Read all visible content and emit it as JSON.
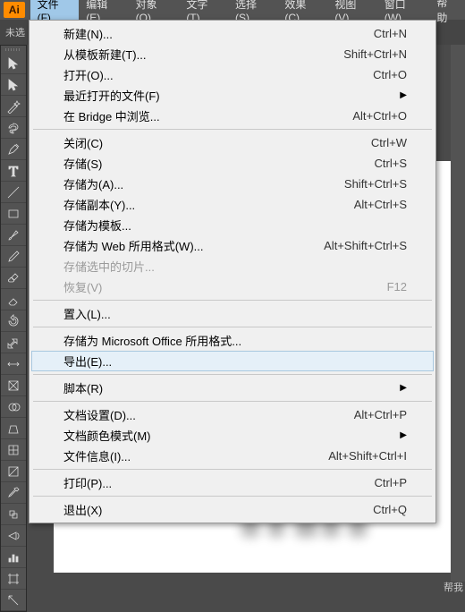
{
  "app_icon": "Ai",
  "menubar": [
    {
      "label": "文件(F)",
      "active": true
    },
    {
      "label": "编辑(E)"
    },
    {
      "label": "对象(O)"
    },
    {
      "label": "文字(T)"
    },
    {
      "label": "选择(S)"
    },
    {
      "label": "效果(C)"
    },
    {
      "label": "视图(V)"
    },
    {
      "label": "窗口(W)"
    },
    {
      "label": "帮助"
    }
  ],
  "subbar": {
    "label": "未选"
  },
  "right_label": "帮我",
  "dropdown": {
    "groups": [
      [
        {
          "label": "新建(N)...",
          "shortcut": "Ctrl+N"
        },
        {
          "label": "从模板新建(T)...",
          "shortcut": "Shift+Ctrl+N"
        },
        {
          "label": "打开(O)...",
          "shortcut": "Ctrl+O"
        },
        {
          "label": "最近打开的文件(F)",
          "arrow": true
        },
        {
          "label": "在 Bridge 中浏览...",
          "shortcut": "Alt+Ctrl+O"
        }
      ],
      [
        {
          "label": "关闭(C)",
          "shortcut": "Ctrl+W"
        },
        {
          "label": "存储(S)",
          "shortcut": "Ctrl+S"
        },
        {
          "label": "存储为(A)...",
          "shortcut": "Shift+Ctrl+S"
        },
        {
          "label": "存储副本(Y)...",
          "shortcut": "Alt+Ctrl+S"
        },
        {
          "label": "存储为模板...",
          "shortcut": ""
        },
        {
          "label": "存储为 Web 所用格式(W)...",
          "shortcut": "Alt+Shift+Ctrl+S"
        },
        {
          "label": "存储选中的切片...",
          "disabled": true
        },
        {
          "label": "恢复(V)",
          "shortcut": "F12",
          "disabled": true
        }
      ],
      [
        {
          "label": "置入(L)...",
          "shortcut": ""
        }
      ],
      [
        {
          "label": "存储为 Microsoft Office 所用格式...",
          "shortcut": ""
        },
        {
          "label": "导出(E)...",
          "hover": true
        }
      ],
      [
        {
          "label": "脚本(R)",
          "arrow": true
        }
      ],
      [
        {
          "label": "文档设置(D)...",
          "shortcut": "Alt+Ctrl+P"
        },
        {
          "label": "文档颜色模式(M)",
          "arrow": true
        },
        {
          "label": "文件信息(I)...",
          "shortcut": "Alt+Shift+Ctrl+I"
        }
      ],
      [
        {
          "label": "打印(P)...",
          "shortcut": "Ctrl+P"
        }
      ],
      [
        {
          "label": "退出(X)",
          "shortcut": "Ctrl+Q"
        }
      ]
    ]
  },
  "tools": [
    "selection",
    "direct-selection",
    "magic-wand",
    "lasso",
    "pen",
    "type",
    "line",
    "rectangle",
    "paintbrush",
    "pencil",
    "blob-brush",
    "eraser",
    "rotate",
    "scale",
    "width",
    "free-transform",
    "shape-builder",
    "perspective",
    "mesh",
    "gradient",
    "eyedropper",
    "blend",
    "symbol-sprayer",
    "column-graph",
    "artboard",
    "slice"
  ]
}
